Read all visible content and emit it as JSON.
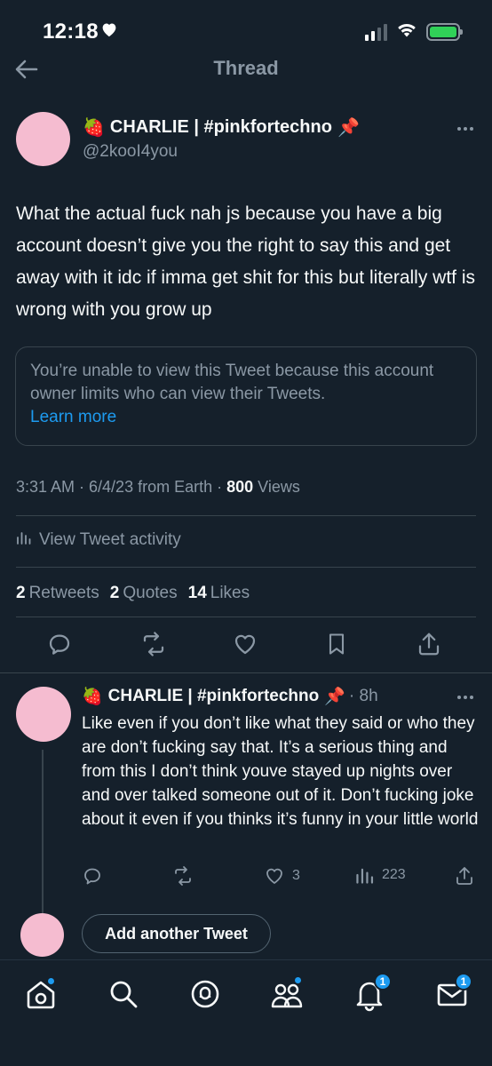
{
  "status_bar": {
    "time": "12:18"
  },
  "header": {
    "title": "Thread"
  },
  "main_tweet": {
    "author_emoji": "🍓",
    "author_name": "CHARLIE | #pinkfortechno",
    "author_pin": "📌",
    "handle": "@2kooI4you",
    "text": "What the actual fuck nah js because you have a big account doesn’t give you the right to say this and get away with it idc if imma get shit for this but literally wtf is wrong with you grow up",
    "limited_notice": "You’re unable to view this Tweet because this account owner limits who can view their Tweets.",
    "learn_more": "Learn more",
    "timestamp": "3:31 AM · 6/4/23 from Earth · ",
    "views_count": "800",
    "views_label": " Views",
    "activity_label": "View Tweet activity",
    "retweets_count": "2",
    "retweets_label": "Retweets",
    "quotes_count": "2",
    "quotes_label": "Quotes",
    "likes_count": "14",
    "likes_label": "Likes"
  },
  "reply": {
    "author_emoji": "🍓",
    "author_name": "CHARLIE | #pinkfortechno",
    "author_pin": "📌",
    "time": "· 8h",
    "text": "Like even if you don’t like what they said or who they are don’t fucking say that. It’s a serious thing and from this I don’t think youve stayed up nights over and over talked someone out of it. Don’t fucking joke about it even if you thinks it’s funny in your little world",
    "likes": "3",
    "views": "223"
  },
  "compose": {
    "add_another_label": "Add another Tweet"
  },
  "bottom_nav": {
    "notifications_badge": "1",
    "messages_badge": "1"
  },
  "colors": {
    "background": "#15202b",
    "accent": "#1d9bf0",
    "avatar": "#f5bcd0",
    "muted": "#8b98a5"
  }
}
